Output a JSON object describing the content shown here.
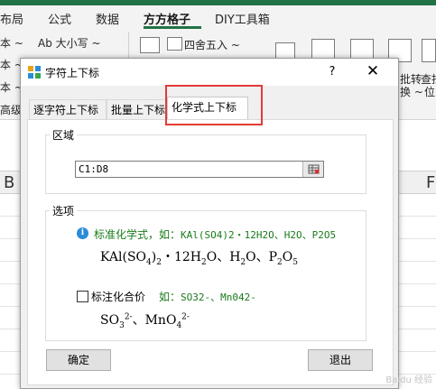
{
  "excel": {
    "ribbon_tabs": [
      "布局",
      "公式",
      "数据",
      "方方格子",
      "DIY工具箱"
    ],
    "active_tab": "方方格子",
    "ribbon_items": {
      "left_label_1": "本 ~",
      "left_label_2": "本 ~",
      "left_label_3": "本 ~",
      "left_label_4": "高级",
      "case_button": "Ab 大小写 ~",
      "round_button": "四舍五入 ~",
      "convert_label": "批转",
      "convert_label_2": "换 ~",
      "find_label": "查找",
      "find_label_2": "位"
    },
    "column_headers": [
      "B",
      "F"
    ]
  },
  "dialog": {
    "title": "字符上下标",
    "help_label": "?",
    "close_label": "✕",
    "tabs": [
      {
        "label": "逐字符上下标"
      },
      {
        "label": "批量上下标"
      },
      {
        "label": "化学式上下标"
      }
    ],
    "region": {
      "label": "区域",
      "value": "C1:D8"
    },
    "options": {
      "label": "选项",
      "standard_label": "标准化学式，如：",
      "standard_example": "KAl(SO4)2・12H2O、H2O、P2O5",
      "standard_preview": {
        "kal": "KAl(SO",
        "kal_sub4": "4",
        "kal_close": ")",
        "kal_sub2": "2",
        "dot": "・12H",
        "h_sub2": "2",
        "o": "O、H",
        "h2_sub": "2",
        "o2": "O、P",
        "p_sub2": "2",
        "o3": "O",
        "o_sub5": "5"
      },
      "charge_label": "标注化合价",
      "charge_example_prefix": "如：",
      "charge_example": "SO32-、Mn042-",
      "charge_preview": {
        "so": "SO",
        "so_sub": "3",
        "so_sup": "2-",
        "sep": "、MnO",
        "mn_sub": "4",
        "mn_sup": "2-"
      },
      "charge_checked": false
    },
    "buttons": {
      "ok": "确定",
      "exit": "退出"
    }
  },
  "colors": {
    "excel_green": "#217346",
    "highlight": "#e53935",
    "example_green": "#1a7a1a",
    "info_blue": "#2a8cd8"
  },
  "watermark": "Baidu 经验"
}
